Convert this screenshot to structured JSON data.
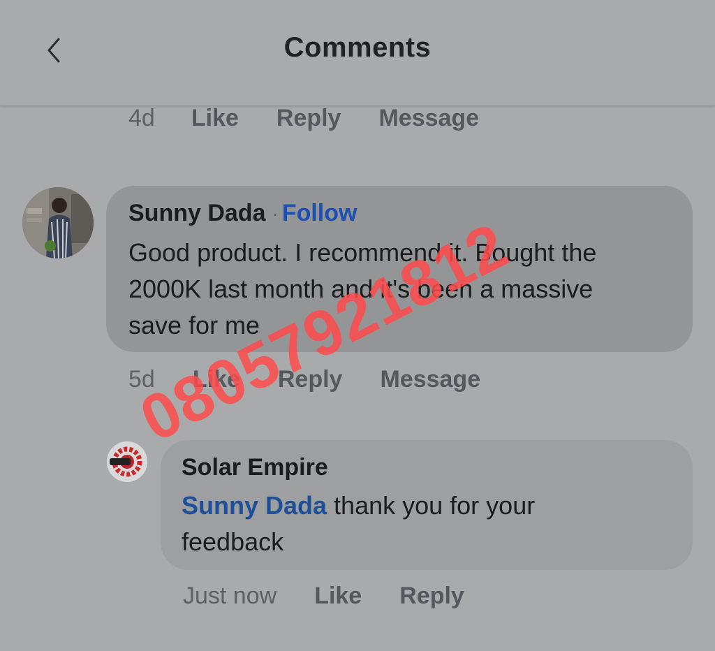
{
  "header": {
    "title": "Comments",
    "back_icon": "chevron-left-icon"
  },
  "previous_comment_actions": {
    "time": "4d",
    "like": "Like",
    "reply": "Reply",
    "message": "Message"
  },
  "comments": [
    {
      "author": "Sunny Dada",
      "separator": "·",
      "follow": "Follow",
      "text_lines": [
        "Good product. I recommend it. Bought the",
        "2000K last month and it's been a massive",
        "save for me"
      ],
      "actions": {
        "time": "5d",
        "like": "Like",
        "reply": "Reply",
        "message": "Message"
      },
      "avatar": "user-avatar"
    }
  ],
  "reply": {
    "author": "Solar Empire",
    "mention": "Sunny Dada",
    "text_line1": " thank you for your",
    "text_line2": "feedback",
    "actions": {
      "time": "Just now",
      "like": "Like",
      "reply": "Reply"
    },
    "avatar": "page-logo-avatar"
  },
  "watermark": "08057921812",
  "colors": {
    "background": "#a9aaab",
    "bubble": "#949597",
    "link_blue": "#1d4fb3",
    "watermark": "#ff4b4b"
  }
}
